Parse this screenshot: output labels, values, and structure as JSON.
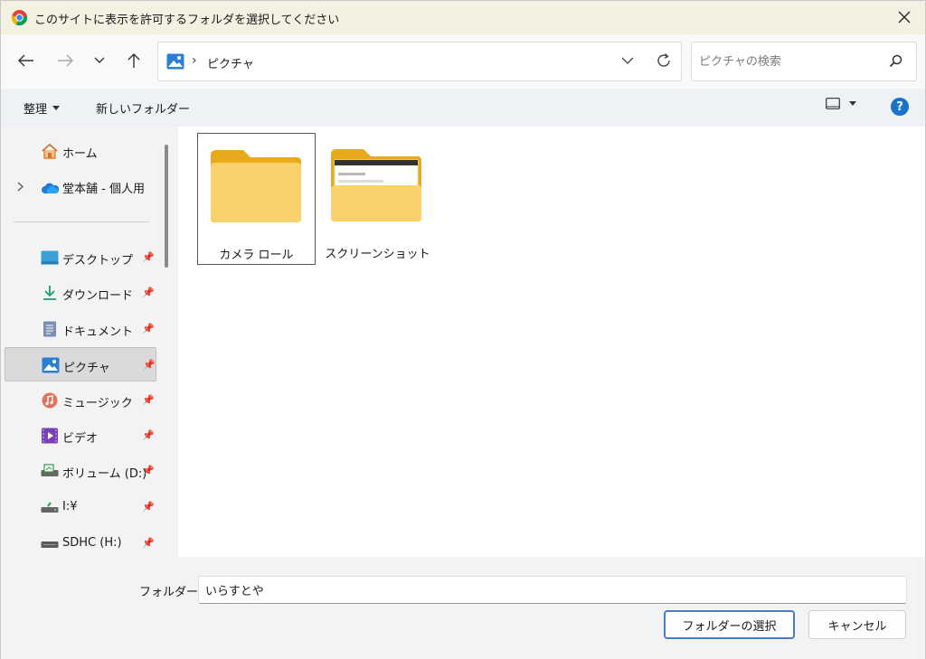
{
  "title": "このサイトに表示を許可するフォルダを選択してください",
  "address": {
    "current": "ピクチャ"
  },
  "search": {
    "placeholder": "ピクチャの検索"
  },
  "toolbar": {
    "organize": "整理",
    "new_folder": "新しいフォルダー",
    "help": "?"
  },
  "sidebar": {
    "items": [
      {
        "label": "ホーム",
        "icon": "home-icon"
      },
      {
        "label": "堂本舗 - 個人用",
        "icon": "onedrive-icon"
      },
      {
        "label": "デスクトップ",
        "icon": "desktop-icon",
        "pinned": true
      },
      {
        "label": "ダウンロード",
        "icon": "download-icon",
        "pinned": true
      },
      {
        "label": "ドキュメント",
        "icon": "document-icon",
        "pinned": true
      },
      {
        "label": "ピクチャ",
        "icon": "pictures-icon",
        "pinned": true,
        "selected": true
      },
      {
        "label": "ミュージック",
        "icon": "music-icon",
        "pinned": true
      },
      {
        "label": "ビデオ",
        "icon": "video-icon",
        "pinned": true
      },
      {
        "label": "ボリューム (D:)",
        "icon": "drive-icon",
        "pinned": true
      },
      {
        "label": "I:¥",
        "icon": "drive-icon",
        "pinned": true
      },
      {
        "label": "SDHC (H:)",
        "icon": "drive-icon",
        "pinned": true
      }
    ]
  },
  "folders": [
    {
      "label": "カメラ ロール",
      "selected": true
    },
    {
      "label": "スクリーンショット",
      "selected": false
    }
  ],
  "footer": {
    "folder_label": "フォルダー:",
    "folder_value": "いらすとや",
    "select_button": "フォルダーの選択",
    "cancel_button": "キャンセル"
  },
  "colors": {
    "accent": "#1a73c8",
    "folder": "#f7c948",
    "selected_border": "#4a7cc1"
  }
}
